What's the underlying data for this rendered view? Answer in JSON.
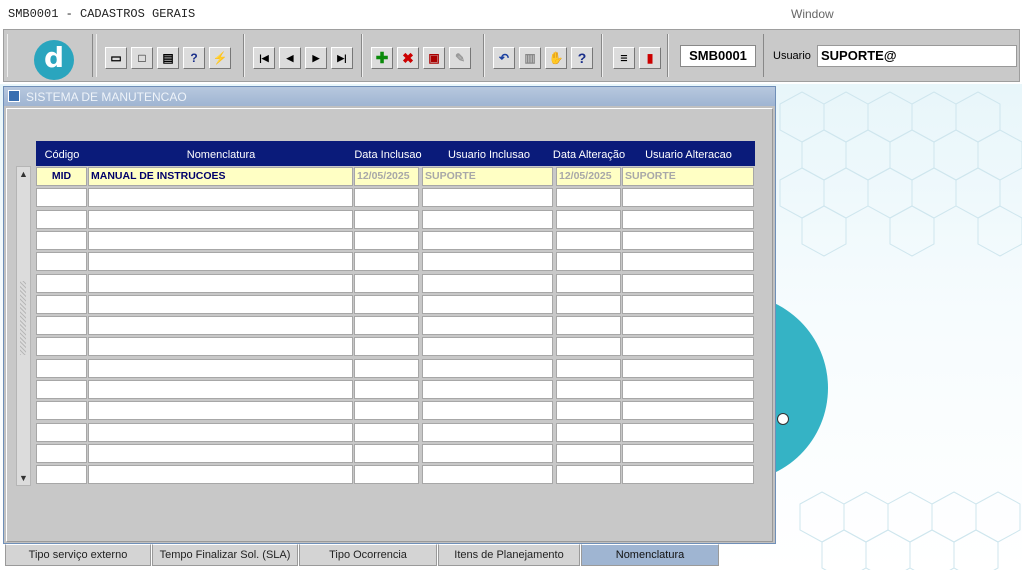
{
  "window": {
    "title": "SMB0001 - CADASTROS GERAIS",
    "menu_window": "Window"
  },
  "toolbar": {
    "logo_letter": "d",
    "form_code": "SMB0001",
    "user_label": "Usuario",
    "user_value": "SUPORTE@"
  },
  "form": {
    "title": "SISTEMA DE MANUTENCAO"
  },
  "grid": {
    "columns": [
      "Código",
      "Nomenclatura",
      "Data Inclusao",
      "Usuario Inclusao",
      "Data Alteração",
      "Usuario Alteracao"
    ],
    "rows": [
      [
        "MID",
        "MANUAL DE INSTRUCOES",
        "12/05/2025",
        "SUPORTE",
        "12/05/2025",
        "SUPORTE"
      ]
    ],
    "empty_rows": 14
  },
  "tabs": [
    {
      "label": "Tipo serviço externo",
      "active": false
    },
    {
      "label": "Tempo Finalizar Sol. (SLA)",
      "active": false
    },
    {
      "label": "Tipo Ocorrencia",
      "active": false
    },
    {
      "label": "Itens de Planejamento",
      "active": false
    },
    {
      "label": "Nomenclatura",
      "active": true
    }
  ],
  "icons": {
    "toolbar": [
      "save-icon",
      "window-icon",
      "print-icon",
      "query-help-icon",
      "execute-query-icon",
      "first-record-icon",
      "previous-record-icon",
      "next-record-icon",
      "last-record-icon",
      "add-record-icon",
      "delete-record-icon",
      "clear-record-icon",
      "edit-icon",
      "undo-icon",
      "clipboard-icon",
      "tools-icon",
      "help-icon",
      "menu-icon",
      "exit-icon"
    ]
  },
  "colors": {
    "header_bg": "#0a1b7a",
    "active_row": "#ffffc4",
    "accent": "#35b3c5"
  }
}
